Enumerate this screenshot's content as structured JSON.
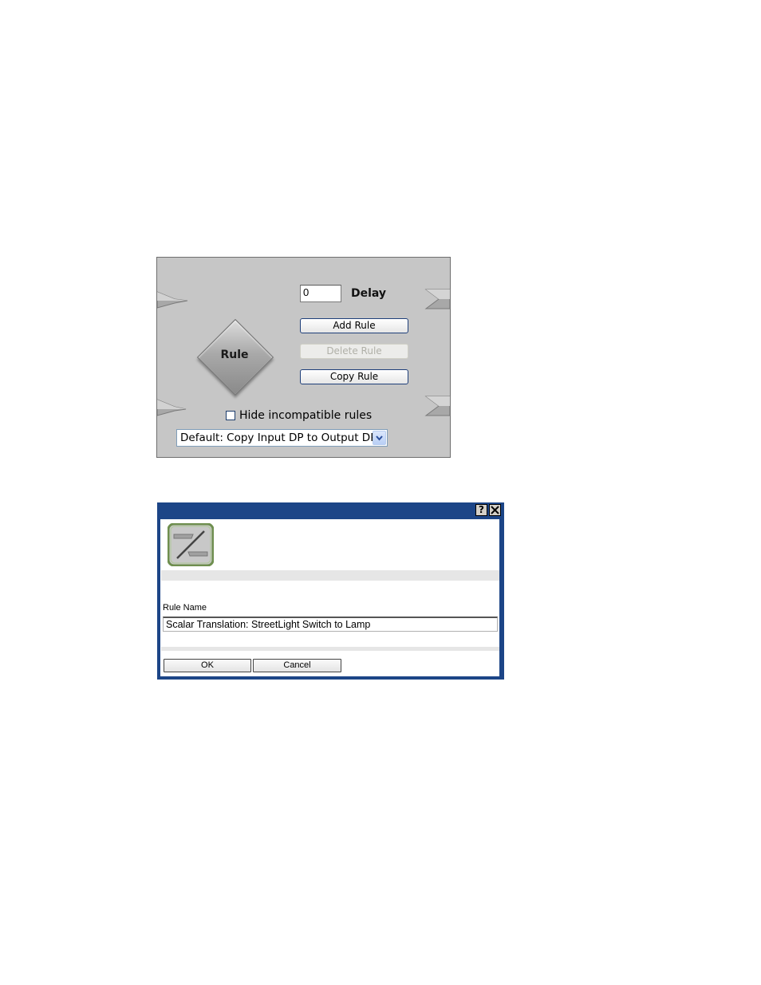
{
  "rule_panel": {
    "block_label": "Rule",
    "delay_value": "0",
    "delay_label": "Delay",
    "add_rule_label": "Add Rule",
    "delete_rule_label": "Delete Rule",
    "copy_rule_label": "Copy Rule",
    "hide_incompatible_label": "Hide incompatible rules",
    "hide_incompatible_checked": false,
    "selected_rule": "Default: Copy Input DP to Output DP",
    "colors": {
      "panel_bg": "#c6c6c6",
      "button_border": "#1f3f7a"
    }
  },
  "rule_name_dialog": {
    "help_glyph": "?",
    "close_glyph": "✕",
    "field_label": "Rule Name",
    "field_value": "Scalar Translation: StreetLight Switch to Lamp",
    "ok_label": "OK",
    "cancel_label": "Cancel",
    "colors": {
      "title_bar": "#1c4587",
      "icon_frame": "#6f8f4f"
    }
  }
}
